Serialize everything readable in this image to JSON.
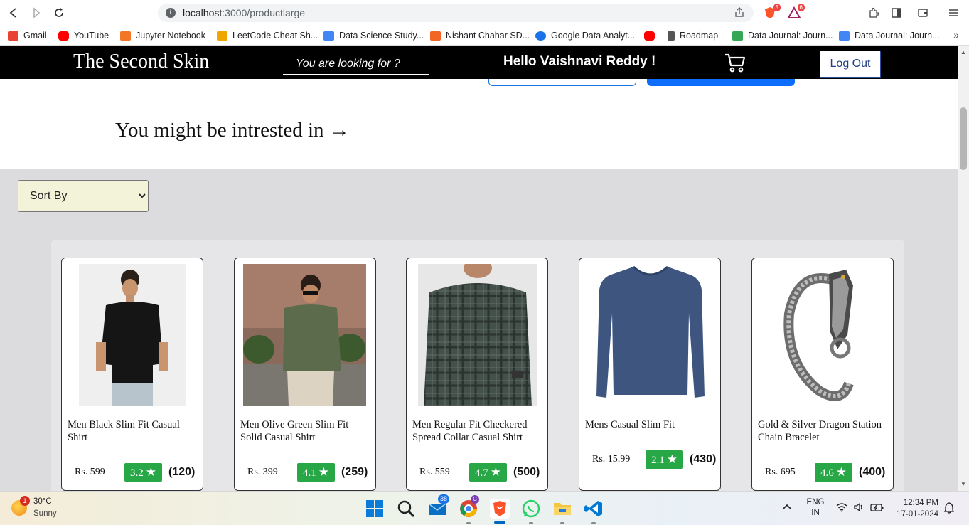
{
  "browser": {
    "url_host": "localhost",
    "url_path": ":3000/productlarge",
    "brave_badge": "5",
    "rewards_badge": "6",
    "bookmarks": [
      {
        "label": "Gmail",
        "color": "#ea4335"
      },
      {
        "label": "YouTube",
        "color": "#ff0000"
      },
      {
        "label": "Jupyter Notebook",
        "color": "#f37626"
      },
      {
        "label": "LeetCode Cheat Sh...",
        "color": "#f0a500"
      },
      {
        "label": "Data Science Study...",
        "color": "#4285f4"
      },
      {
        "label": "Nishant Chahar SD...",
        "color": "#f26522"
      },
      {
        "label": "Google Data Analyt...",
        "color": "#1a73e8"
      },
      {
        "label": "",
        "color": "#ff0000"
      },
      {
        "label": "Roadmap",
        "color": "#555555"
      },
      {
        "label": "Data Journal: Journ...",
        "color": "#34a853"
      },
      {
        "label": "Data Journal: Journ...",
        "color": "#4285f4"
      }
    ]
  },
  "header": {
    "brand": "The Second Skin",
    "search_placeholder": "You are looking for ?",
    "greeting": "Hello Vaishnavi Reddy !",
    "logout_label": "Log Out"
  },
  "section": {
    "title": "You might be intrested in →"
  },
  "sort": {
    "selected": "Sort By"
  },
  "products": [
    {
      "name": "Men Black Slim Fit Casual Shirt",
      "price": "Rs. 599",
      "rating": "3.2",
      "count": "(120)"
    },
    {
      "name": "Men Olive Green Slim Fit Solid Casual Shirt",
      "price": "Rs. 399",
      "rating": "4.1",
      "count": "(259)"
    },
    {
      "name": "Men Regular Fit Checkered Spread Collar Casual Shirt",
      "price": "Rs. 559",
      "rating": "4.7",
      "count": "(500)"
    },
    {
      "name": "Mens Casual Slim Fit",
      "price": "Rs. 15.99",
      "rating": "2.1",
      "count": "(430)"
    },
    {
      "name": "Gold & Silver Dragon Station Chain Bracelet",
      "price": "Rs. 695",
      "rating": "4.6",
      "count": "(400)"
    }
  ],
  "taskbar": {
    "weather_temp": "30°C",
    "weather_desc": "Sunny",
    "weather_badge": "1",
    "mail_badge": "38",
    "lang_line1": "ENG",
    "lang_line2": "IN",
    "time": "12:34 PM",
    "date": "17-01-2024"
  }
}
